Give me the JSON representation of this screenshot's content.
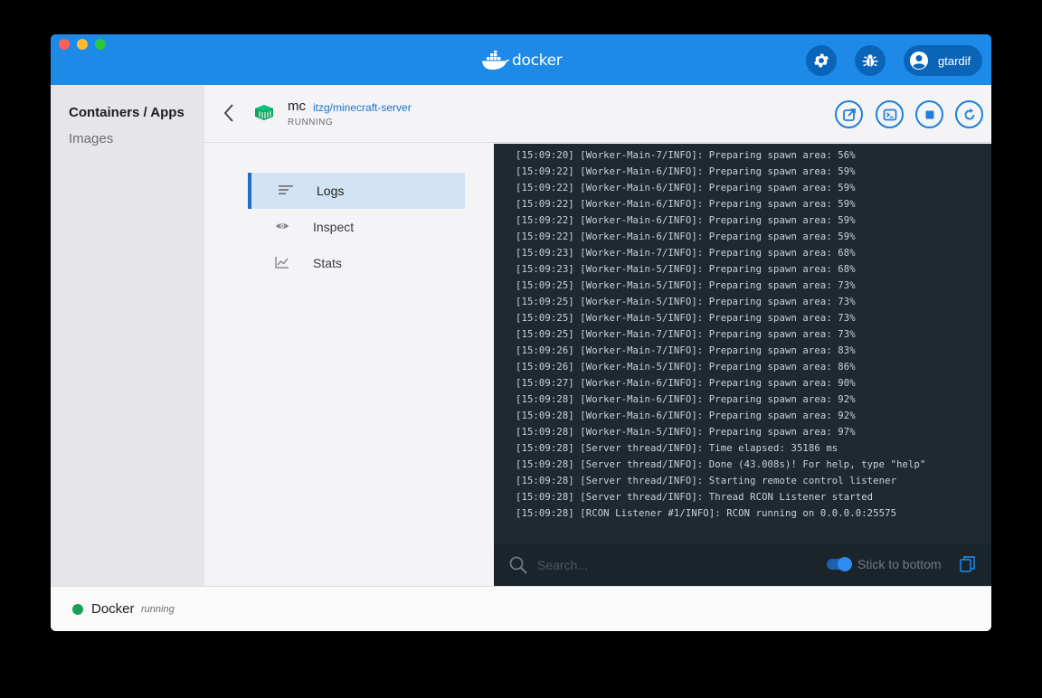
{
  "app": {
    "brand": "docker",
    "user": "gtardif"
  },
  "sidebar": {
    "items": [
      {
        "label": "Containers / Apps"
      },
      {
        "label": "Images"
      }
    ]
  },
  "container": {
    "name": "mc",
    "image": "itzg/minecraft-server",
    "status": "RUNNING"
  },
  "tabs": [
    {
      "label": "Logs",
      "icon": "logs-icon"
    },
    {
      "label": "Inspect",
      "icon": "eye-icon"
    },
    {
      "label": "Stats",
      "icon": "chart-icon"
    }
  ],
  "logs": {
    "lines": [
      "[15:09:20] [Worker-Main-7/INFO]: Preparing spawn area: 56%",
      "[15:09:22] [Worker-Main-6/INFO]: Preparing spawn area: 59%",
      "[15:09:22] [Worker-Main-6/INFO]: Preparing spawn area: 59%",
      "[15:09:22] [Worker-Main-6/INFO]: Preparing spawn area: 59%",
      "[15:09:22] [Worker-Main-6/INFO]: Preparing spawn area: 59%",
      "[15:09:22] [Worker-Main-6/INFO]: Preparing spawn area: 59%",
      "[15:09:23] [Worker-Main-7/INFO]: Preparing spawn area: 68%",
      "[15:09:23] [Worker-Main-5/INFO]: Preparing spawn area: 68%",
      "[15:09:25] [Worker-Main-5/INFO]: Preparing spawn area: 73%",
      "[15:09:25] [Worker-Main-5/INFO]: Preparing spawn area: 73%",
      "[15:09:25] [Worker-Main-5/INFO]: Preparing spawn area: 73%",
      "[15:09:25] [Worker-Main-7/INFO]: Preparing spawn area: 73%",
      "[15:09:26] [Worker-Main-7/INFO]: Preparing spawn area: 83%",
      "[15:09:26] [Worker-Main-5/INFO]: Preparing spawn area: 86%",
      "[15:09:27] [Worker-Main-6/INFO]: Preparing spawn area: 90%",
      "[15:09:28] [Worker-Main-6/INFO]: Preparing spawn area: 92%",
      "[15:09:28] [Worker-Main-6/INFO]: Preparing spawn area: 92%",
      "[15:09:28] [Worker-Main-5/INFO]: Preparing spawn area: 97%",
      "[15:09:28] [Server thread/INFO]: Time elapsed: 35186 ms",
      "[15:09:28] [Server thread/INFO]: Done (43.008s)! For help, type \"help\"",
      "[15:09:28] [Server thread/INFO]: Starting remote control listener",
      "[15:09:28] [Server thread/INFO]: Thread RCON Listener started",
      "[15:09:28] [RCON Listener #1/INFO]: RCON running on 0.0.0.0:25575"
    ],
    "search_placeholder": "Search...",
    "stick_label": "Stick to bottom",
    "stick_enabled": true
  },
  "statusbar": {
    "name": "Docker",
    "state": "running"
  },
  "colors": {
    "accent": "#1d8ae8",
    "running": "#16a05c",
    "log_bg": "#1f2a30"
  }
}
